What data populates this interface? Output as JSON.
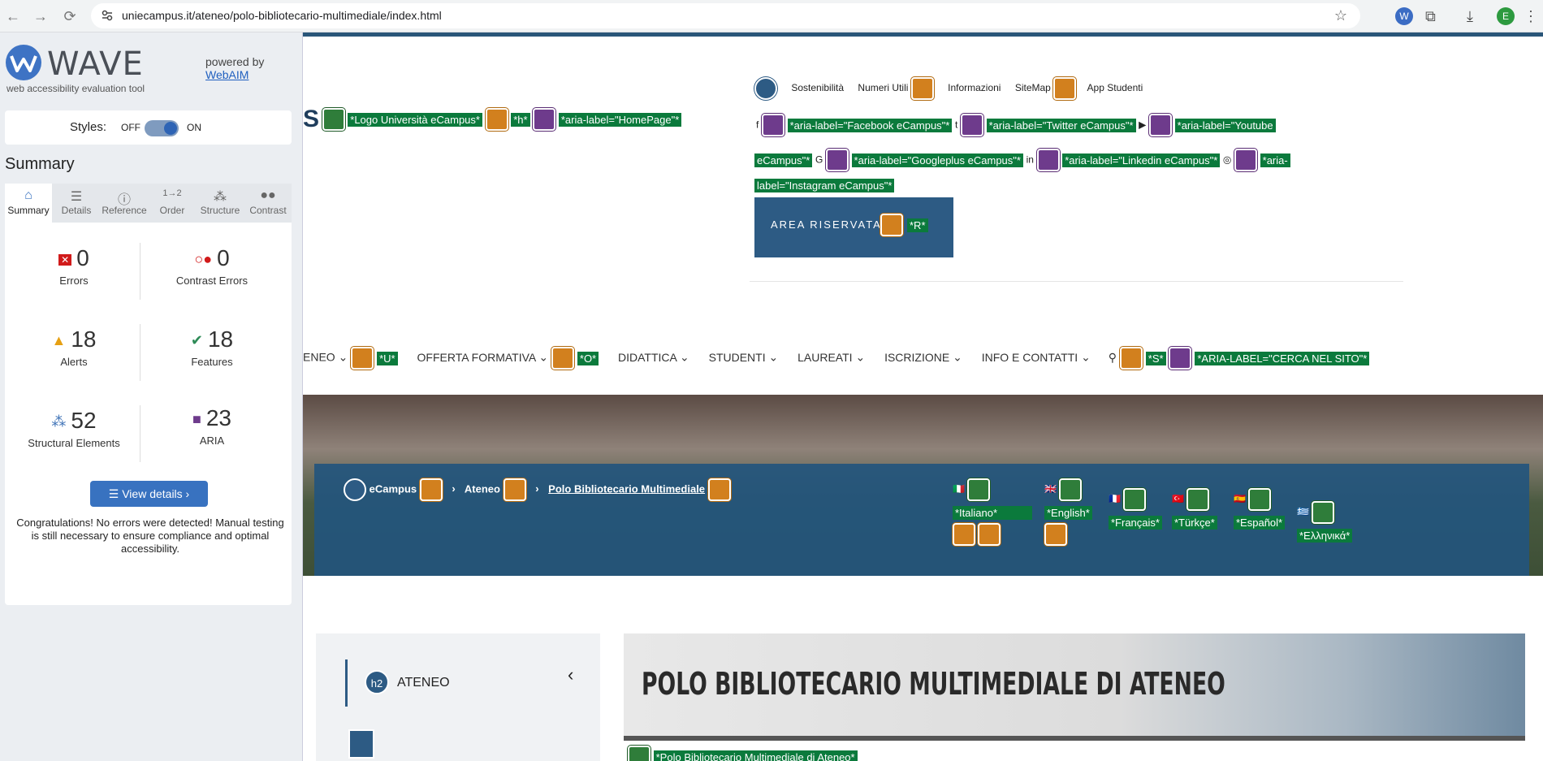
{
  "browser": {
    "url": "uniecampus.it/ateneo/polo-bibliotecario-multimediale/index.html",
    "profile_initial": "E"
  },
  "wave": {
    "title": "WAVE",
    "subtitle": "web accessibility evaluation tool",
    "powered_by": "powered by",
    "powered_link": "WebAIM",
    "styles_label": "Styles:",
    "styles_off": "OFF",
    "styles_on": "ON",
    "summary_title": "Summary",
    "tabs": [
      {
        "label": "Summary",
        "icon": "home-icon"
      },
      {
        "label": "Details",
        "icon": "list-icon"
      },
      {
        "label": "Reference",
        "icon": "info-icon"
      },
      {
        "label": "Order",
        "icon": "order-icon"
      },
      {
        "label": "Structure",
        "icon": "structure-icon"
      },
      {
        "label": "Contrast",
        "icon": "contrast-icon"
      }
    ],
    "stats": {
      "errors": {
        "value": "0",
        "label": "Errors"
      },
      "contrast_errors": {
        "value": "0",
        "label": "Contrast Errors"
      },
      "alerts": {
        "value": "18",
        "label": "Alerts"
      },
      "features": {
        "value": "18",
        "label": "Features"
      },
      "structural": {
        "value": "52",
        "label": "Structural Elements"
      },
      "aria": {
        "value": "23",
        "label": "ARIA"
      }
    },
    "view_details": "View details ›",
    "congrats": "Congratulations! No errors were detected! Manual testing is still necessary to ensure compliance and optimal accessibility.",
    "colors": {
      "error": "#d11b1b",
      "alert": "#e6a013",
      "feature": "#2e8b57",
      "structural": "#3a6fb5",
      "aria": "#6e3b8c",
      "button": "#3872c0"
    }
  },
  "site": {
    "logo_letter": "S",
    "logo_tag": "*Logo Università eCampus*",
    "h_tag": "*h*",
    "homepage_tag": "*aria-label=\"HomePage\"*",
    "util_links": [
      "Sostenibilità",
      "Numeri Utili",
      "Informazioni",
      "SiteMap",
      "App Studenti"
    ],
    "social_tags": {
      "facebook": "*aria-label=\"Facebook eCampus\"*",
      "twitter": "*aria-label=\"Twitter eCampus\"*",
      "youtube_a": "*aria-label=\"Youtube",
      "youtube_b": "eCampus\"*",
      "googleplus": "*aria-label=\"Googleplus eCampus\"*",
      "linkedin": "*aria-label=\"Linkedin eCampus\"*",
      "instagram_a": "*aria-",
      "instagram_b": "label=\"Instagram eCampus\"*"
    },
    "area_riservata": "AREA RISERVATA",
    "area_tag": "*R*",
    "menu": {
      "ateneo": "ENEO",
      "ateneo_tag": "*U*",
      "offerta": "OFFERTA FORMATIVA",
      "offerta_tag": "*O*",
      "didattica": "DIDATTICA",
      "studenti": "STUDENTI",
      "laureati": "LAUREATI",
      "iscrizione": "ISCRIZIONE",
      "info": "INFO E CONTATTI",
      "search_tag": "*S*",
      "search_aria": "*ARIA-LABEL=\"CERCA NEL SITO\"*"
    },
    "breadcrumb": [
      "eCampus",
      "Ateneo",
      "Polo Bibliotecario Multimediale"
    ],
    "languages": [
      "*Italiano*",
      "*English*",
      "*Français*",
      "*Türkçe*",
      "*Español*",
      "*Ελληνικά*"
    ],
    "sidebar_heading": "ATENEO",
    "h2_badge": "h2",
    "banner_title": "POLO BIBLIOTECARIO MULTIMEDIALE DI ATENEO",
    "banner_alt": "*Polo Bibliotecario Multimediale di Ateneo*"
  }
}
